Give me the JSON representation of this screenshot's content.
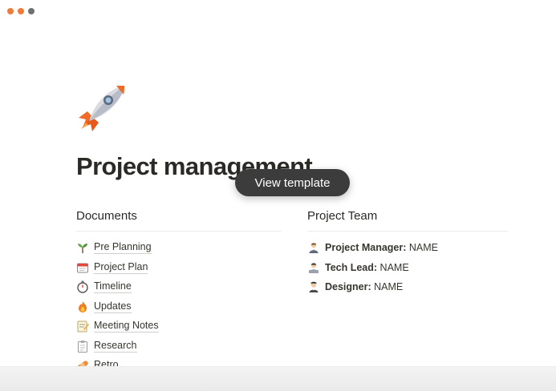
{
  "window": {
    "controls": [
      "close",
      "minimize",
      "zoom"
    ]
  },
  "page": {
    "icon": "rocket-icon",
    "title": "Project management"
  },
  "overlay": {
    "view_template_label": "View template"
  },
  "documents": {
    "heading": "Documents",
    "items": [
      {
        "icon": "seedling-icon",
        "label": "Pre Planning"
      },
      {
        "icon": "calendar-icon",
        "label": "Project Plan"
      },
      {
        "icon": "stopwatch-icon",
        "label": "Timeline"
      },
      {
        "icon": "fire-icon",
        "label": "Updates"
      },
      {
        "icon": "memo-icon",
        "label": "Meeting Notes"
      },
      {
        "icon": "clipboard-icon",
        "label": "Research"
      },
      {
        "icon": "bandage-icon",
        "label": "Retro"
      }
    ]
  },
  "team": {
    "heading": "Project Team",
    "members": [
      {
        "icon": "manager-icon",
        "role": "Project Manager:",
        "name": "NAME"
      },
      {
        "icon": "technologist-icon",
        "role": "Tech Lead:",
        "name": "NAME"
      },
      {
        "icon": "artist-icon",
        "role": "Designer:",
        "name": "NAME"
      }
    ]
  },
  "colors": {
    "accent": "#f07a3a",
    "text": "#37352f",
    "button_bg": "#3c3c3c"
  }
}
